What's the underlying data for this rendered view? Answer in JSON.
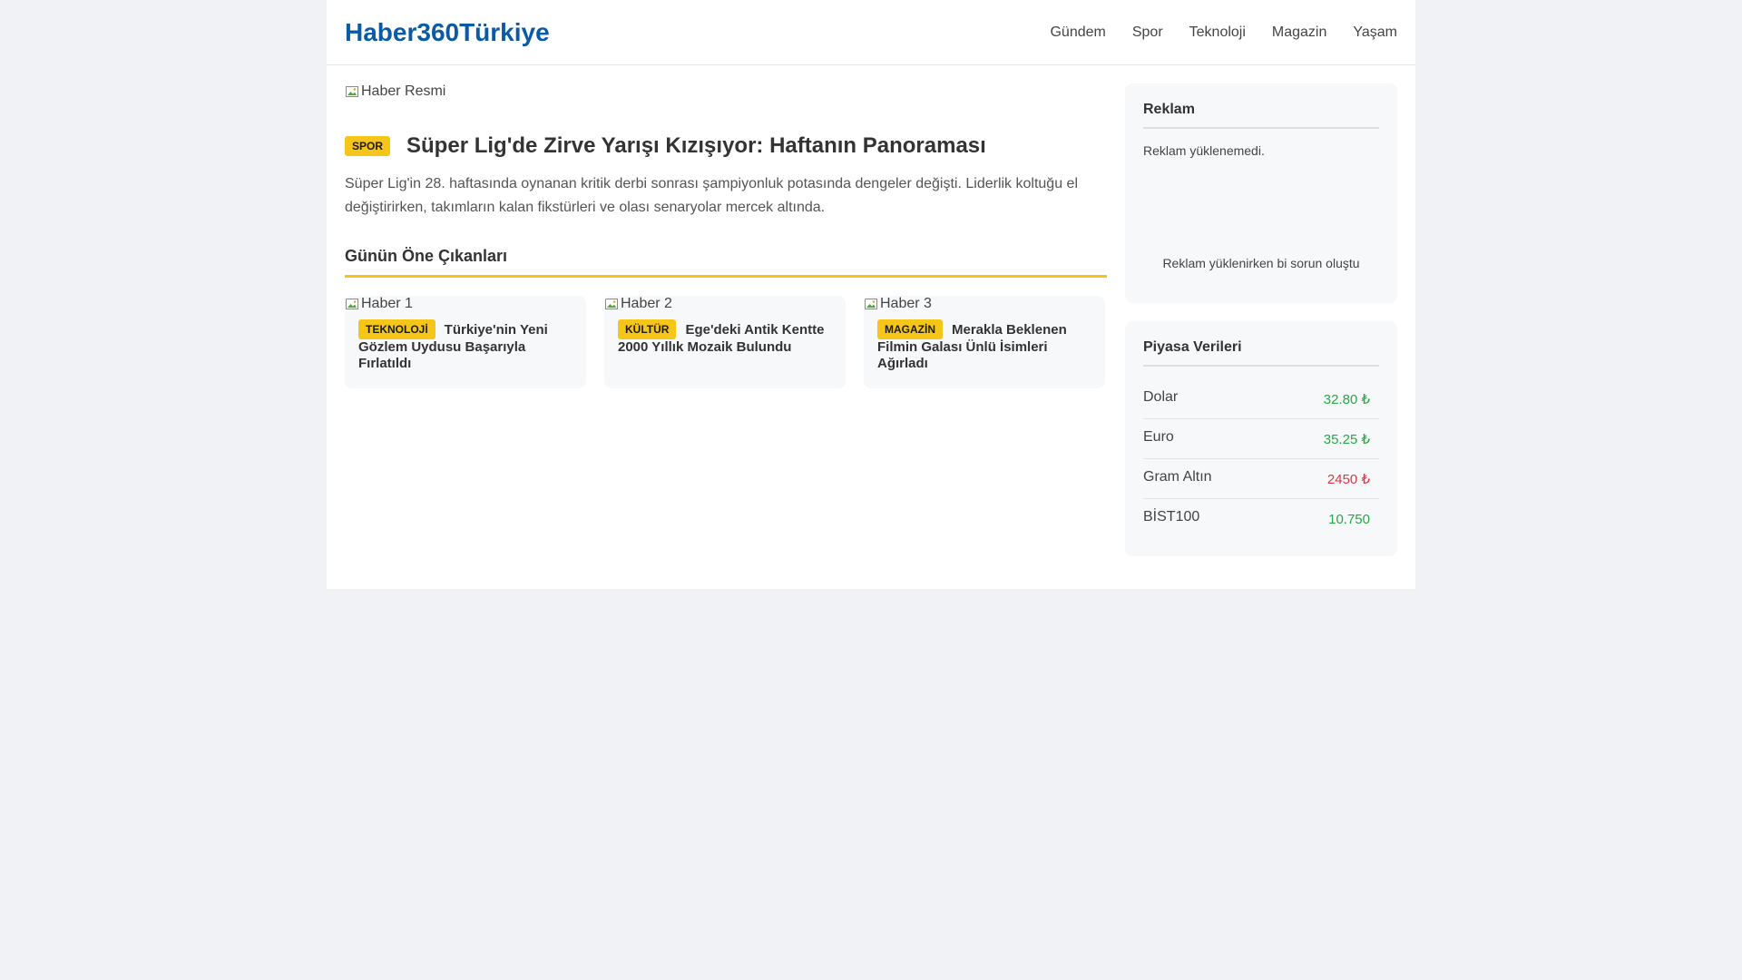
{
  "header": {
    "logo": "Haber360Türkiye",
    "nav": [
      "Gündem",
      "Spor",
      "Teknoloji",
      "Magazin",
      "Yaşam"
    ]
  },
  "featured": {
    "image_alt": "Haber Resmi",
    "category": "SPOR",
    "title": "Süper Lig'de Zirve Yarışı Kızışıyor: Haftanın Panoraması",
    "summary": "Süper Lig'in 28. haftasında oynanan kritik derbi sonrası şampiyonluk potasında dengeler değişti. Liderlik koltuğu el değiştirirken, takımların kalan fikstürleri ve olası senaryolar mercek altında."
  },
  "highlights": {
    "title": "Günün Öne Çıkanları",
    "cards": [
      {
        "image_alt": "Haber 1",
        "category": "TEKNOLOJİ",
        "title": "Türkiye'nin Yeni Gözlem Uydusu Başarıyla Fırlatıldı"
      },
      {
        "image_alt": "Haber 2",
        "category": "KÜLTÜR",
        "title": "Ege'deki Antik Kentte 2000 Yıllık Mozaik Bulundu"
      },
      {
        "image_alt": "Haber 3",
        "category": "MAGAZİN",
        "title": "Merakla Beklenen Filmin Galası Ünlü İsimleri Ağırladı"
      }
    ]
  },
  "ad": {
    "title": "Reklam",
    "error": "Reklam yüklenemedi.",
    "placeholder": "Reklam yüklenirken bi sorun oluştu"
  },
  "market": {
    "title": "Piyasa Verileri",
    "rows": [
      {
        "name": "Dolar",
        "value": "32.80 ₺",
        "trend": "up"
      },
      {
        "name": "Euro",
        "value": "35.25 ₺",
        "trend": "up"
      },
      {
        "name": "Gram Altın",
        "value": "2450 ₺",
        "trend": "down"
      },
      {
        "name": "BİST100",
        "value": "10.750",
        "trend": "up"
      }
    ]
  },
  "colors": {
    "brand": "#0b5aa5",
    "accent": "#f5c518",
    "up": "#28a745",
    "down": "#dc3545"
  }
}
